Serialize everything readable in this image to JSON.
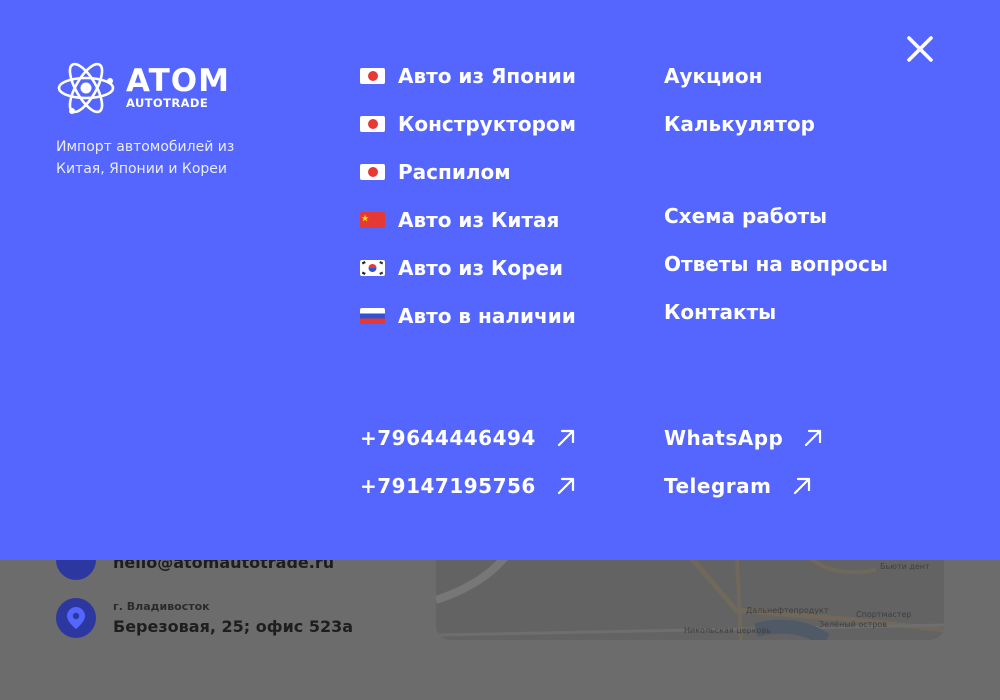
{
  "brand": {
    "logo_title": "ATOM",
    "logo_subtitle": "AUTOTRADE",
    "tagline": "Импорт автомобилей из Китая, Японии и Кореи"
  },
  "menu": {
    "close_icon": "close-icon",
    "col1": [
      {
        "label": "Авто из Японии",
        "flag": "japan"
      },
      {
        "label": "Конструктором",
        "flag": "japan"
      },
      {
        "label": "Распилом",
        "flag": "japan"
      },
      {
        "label": "Авто из Китая",
        "flag": "china"
      },
      {
        "label": "Авто из Кореи",
        "flag": "south-korea"
      },
      {
        "label": "Авто в наличии",
        "flag": "russia"
      }
    ],
    "col2_group1": [
      {
        "label": "Аукцион"
      },
      {
        "label": "Калькулятор"
      }
    ],
    "col2_group2": [
      {
        "label": "Схема работы"
      },
      {
        "label": "Ответы на вопросы"
      },
      {
        "label": "Контакты"
      }
    ],
    "contacts": {
      "phone1": "+79644446494",
      "phone2": "+79147195756",
      "whatsapp": "WhatsApp",
      "telegram": "Telegram",
      "arrow_icon": "arrow-up-right-icon"
    }
  },
  "background_page": {
    "email": "hello@atomautotrade.ru",
    "city": "г. Владивосток",
    "address": "Березовая, 25; офис 523а",
    "map_labels": [
      "Дальнефтепродукт",
      "Спортмастер",
      "Зелёный остров",
      "Никольская церковь",
      "Бьюти дент"
    ]
  },
  "colors": {
    "overlay": "#5466FE",
    "text": "#FFFFFF",
    "dim_background": "#6C6C6C",
    "pin_blue": "#2C37A0"
  }
}
